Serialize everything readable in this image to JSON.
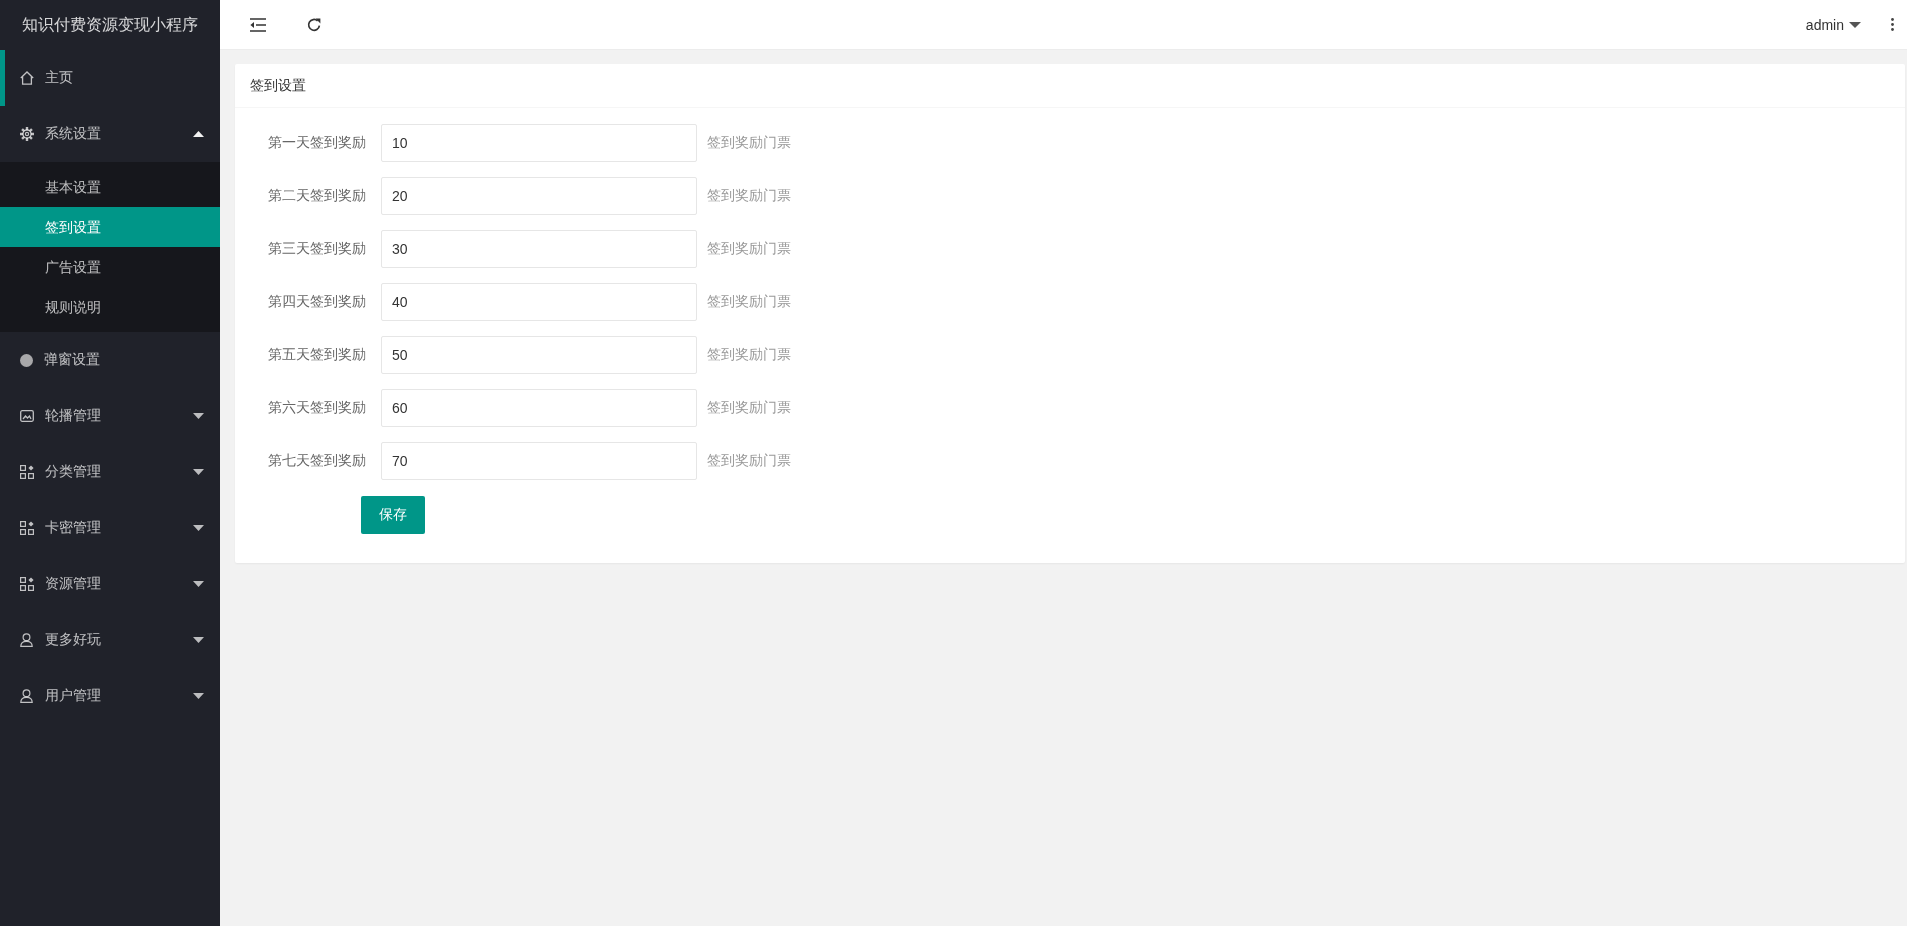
{
  "sidebar": {
    "title": "知识付费资源变现小程序",
    "items": [
      {
        "label": "主页",
        "kind": "link",
        "indicator": true
      },
      {
        "label": "系统设置",
        "kind": "group",
        "indicator": false,
        "expanded": true,
        "children": [
          {
            "label": "基本设置",
            "selected": false
          },
          {
            "label": "签到设置",
            "selected": true
          },
          {
            "label": "广告设置",
            "selected": false
          },
          {
            "label": "规则说明",
            "selected": false
          }
        ]
      },
      {
        "label": "弹窗设置",
        "kind": "link",
        "indicator": false
      },
      {
        "label": "轮播管理",
        "kind": "group",
        "indicator": false,
        "expanded": false
      },
      {
        "label": "分类管理",
        "kind": "group",
        "indicator": false,
        "expanded": false
      },
      {
        "label": "卡密管理",
        "kind": "group",
        "indicator": false,
        "expanded": false
      },
      {
        "label": "资源管理",
        "kind": "group",
        "indicator": false,
        "expanded": false
      },
      {
        "label": "更多好玩",
        "kind": "group",
        "indicator": false,
        "expanded": false
      },
      {
        "label": "用户管理",
        "kind": "group",
        "indicator": false,
        "expanded": false
      }
    ]
  },
  "header": {
    "user": "admin"
  },
  "card": {
    "title": "签到设置",
    "fields": [
      {
        "label": "第一天签到奖励",
        "value": "10",
        "hint": "签到奖励门票"
      },
      {
        "label": "第二天签到奖励",
        "value": "20",
        "hint": "签到奖励门票"
      },
      {
        "label": "第三天签到奖励",
        "value": "30",
        "hint": "签到奖励门票"
      },
      {
        "label": "第四天签到奖励",
        "value": "40",
        "hint": "签到奖励门票"
      },
      {
        "label": "第五天签到奖励",
        "value": "50",
        "hint": "签到奖励门票"
      },
      {
        "label": "第六天签到奖励",
        "value": "60",
        "hint": "签到奖励门票"
      },
      {
        "label": "第七天签到奖励",
        "value": "70",
        "hint": "签到奖励门票"
      }
    ],
    "submit": "保存"
  }
}
